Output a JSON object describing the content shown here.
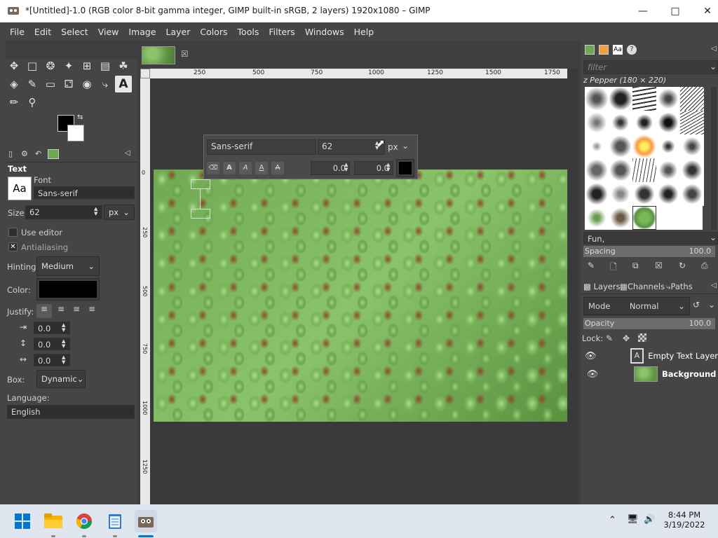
{
  "window": {
    "title": "*[Untitled]-1.0 (RGB color 8-bit gamma integer, GIMP built-in sRGB, 2 layers) 1920x1080 – GIMP"
  },
  "menu": [
    "File",
    "Edit",
    "Select",
    "View",
    "Image",
    "Layer",
    "Colors",
    "Tools",
    "Filters",
    "Windows",
    "Help"
  ],
  "tool_options": {
    "title": "Text",
    "font_label": "Font",
    "font_preview": "Aa",
    "font_value": "Sans-serif",
    "size_label": "Size:",
    "size_value": "62",
    "size_unit": "px",
    "use_editor": "Use editor",
    "antialiasing": "Antialiasing",
    "hinting_label": "Hinting:",
    "hinting_value": "Medium",
    "color_label": "Color:",
    "color_value": "#000000",
    "justify_label": "Justify:",
    "indent_value": "0.0",
    "line_spacing_value": "0.0",
    "letter_spacing_value": "0.0",
    "box_label": "Box:",
    "box_value": "Dynamic",
    "language_label": "Language:",
    "language_value": "English"
  },
  "ruler": {
    "top_ticks": [
      "250",
      "500",
      "750",
      "1000",
      "1250",
      "1500",
      "1750"
    ],
    "left_ticks": [
      "0",
      "250",
      "500",
      "750",
      "1000",
      "1250"
    ]
  },
  "text_overlay": {
    "font": "Sans-serif",
    "size": "62",
    "unit": "px",
    "baseline": "0.0",
    "kerning": "0.0"
  },
  "brushes": {
    "filter_placeholder": "filter",
    "current": "z Pepper (180 × 220)",
    "tag": "Fun,",
    "spacing_label": "Spacing",
    "spacing_value": "100.0"
  },
  "layers_panel": {
    "tabs": [
      "Layers",
      "Channels",
      "Paths"
    ],
    "mode_label": "Mode",
    "mode_value": "Normal",
    "opacity_label": "Opacity",
    "opacity_value": "100.0",
    "lock_label": "Lock:",
    "layers": [
      {
        "name": "Empty Text Layer"
      },
      {
        "name": "Background"
      }
    ]
  },
  "taskbar": {
    "time": "8:44 PM",
    "date": "3/19/2022"
  },
  "colors": {
    "fg": "#000000",
    "bg": "#ffffff",
    "accent": "#0078d4"
  }
}
